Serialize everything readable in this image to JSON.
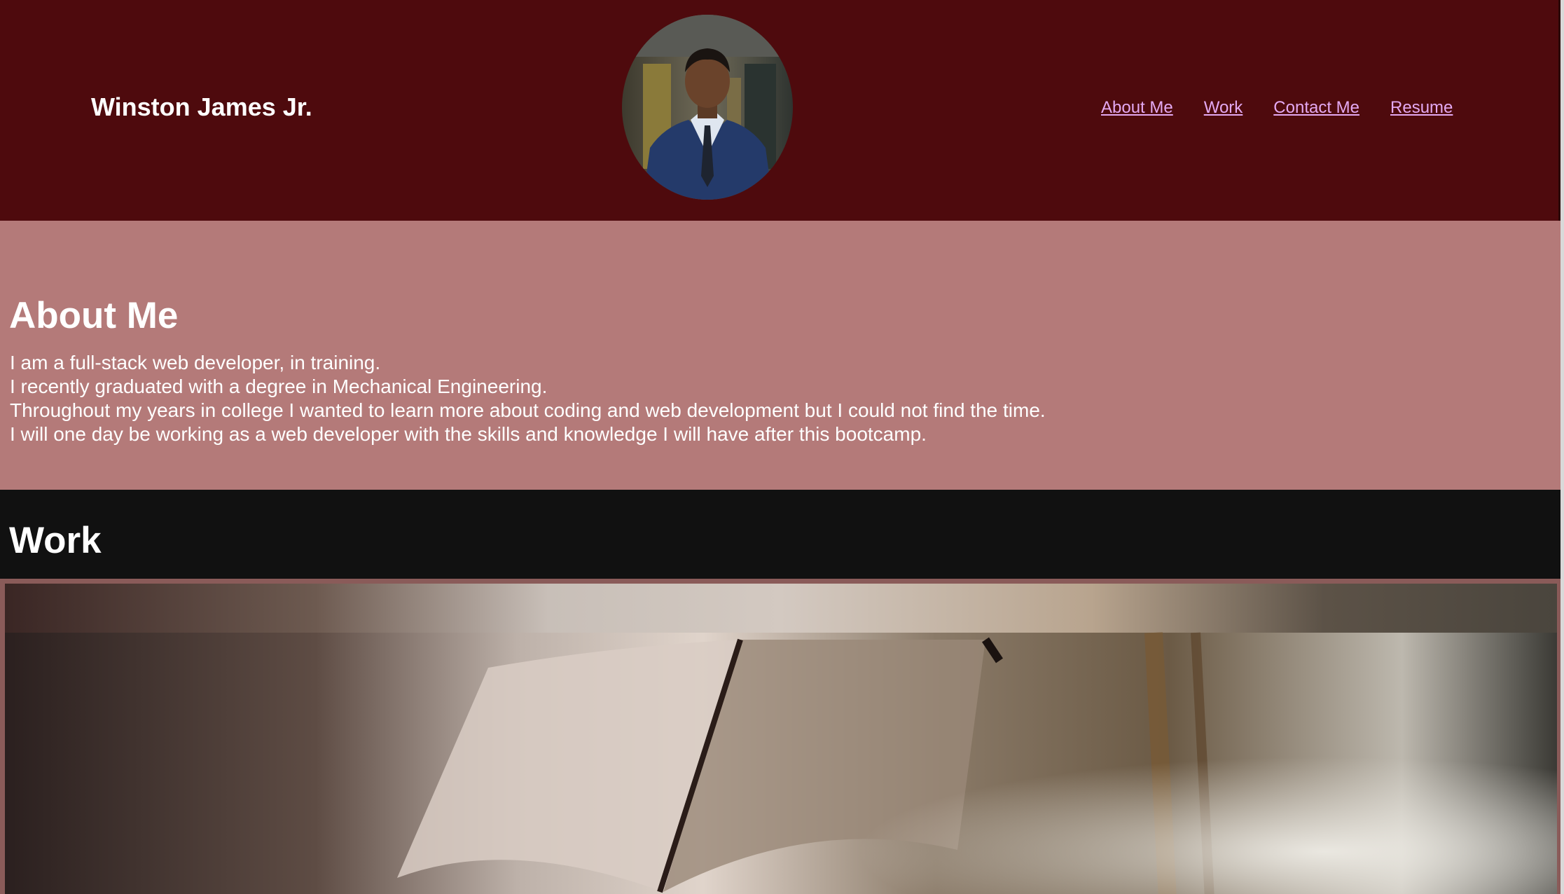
{
  "header": {
    "name": "Winston James Jr.",
    "avatar_icon": "profile-photo",
    "nav": [
      {
        "label": "About Me"
      },
      {
        "label": "Work"
      },
      {
        "label": "Contact Me"
      },
      {
        "label": "Resume"
      }
    ]
  },
  "about": {
    "heading": "About Me",
    "lines": [
      "I am a full-stack web developer, in training.",
      "I recently graduated with a degree in Mechanical Engineering.",
      "Throughout my years in college I wanted to learn more about coding and web development but I could not find the time.",
      "I will one day be working as a web developer with the skills and knowledge I will have after this bootcamp."
    ]
  },
  "work": {
    "heading": "Work",
    "project_image_icon": "open-book-image"
  },
  "colors": {
    "header_bg": "#4e0a0d",
    "about_bg": "#b47a79",
    "work_bg": "#111111",
    "nav_link": "#e4a9f2",
    "text": "#ffffff"
  }
}
